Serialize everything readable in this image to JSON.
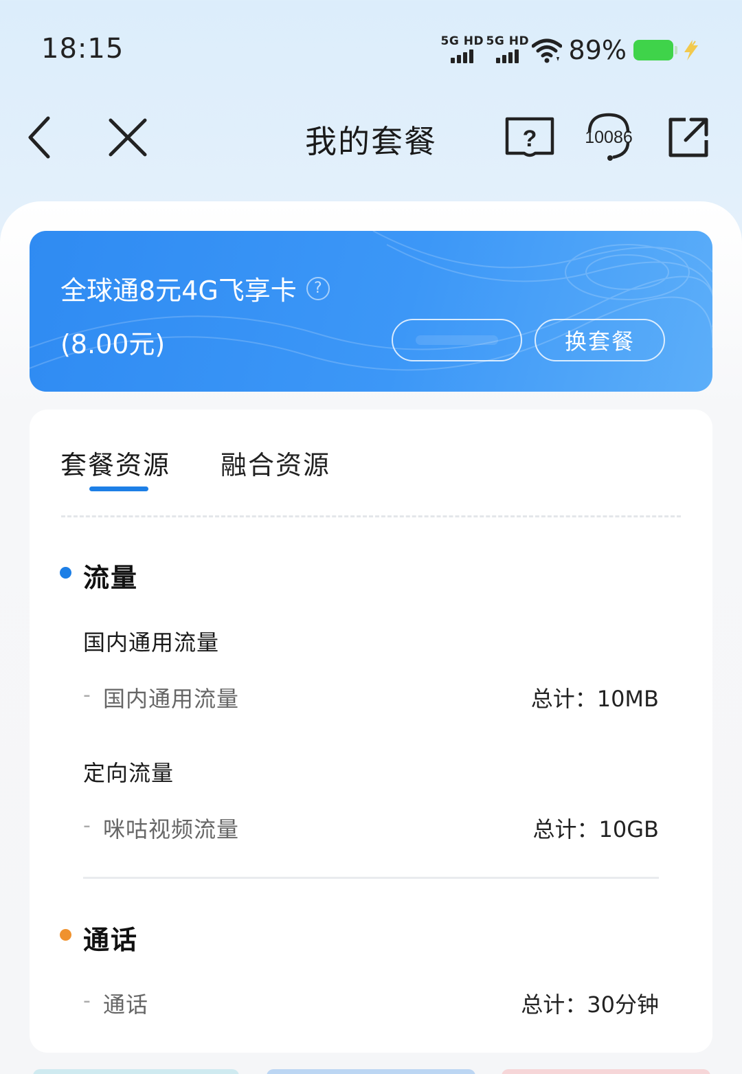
{
  "status_bar": {
    "time": "18:15",
    "sim1_label": "5G HD",
    "sim2_label": "5G HD",
    "battery_percent": "89%",
    "battery_level": 0.89,
    "battery_color": "#3fd34a"
  },
  "nav": {
    "title": "我的套餐",
    "back_icon": "chevron-left-icon",
    "close_icon": "close-icon",
    "help_icon": "help-book-icon",
    "service_icon": "customer-service-icon",
    "service_number": "10086",
    "share_icon": "external-link-icon"
  },
  "plan": {
    "name": "全球通8元4G飞享卡",
    "price": "(8.00元)",
    "change_button": "换套餐",
    "accent": "#2f8bf2"
  },
  "resources": {
    "tabs": [
      {
        "label": "套餐资源",
        "active": true
      },
      {
        "label": "融合资源",
        "active": false
      }
    ],
    "sections": [
      {
        "title": "流量",
        "dot_color": "#1d7fe6",
        "groups": [
          {
            "title": "国内通用流量",
            "rows": [
              {
                "dash": "-",
                "label": "国内通用流量",
                "value": "总计：10MB"
              }
            ]
          },
          {
            "title": "定向流量",
            "rows": [
              {
                "dash": "-",
                "label": "咪咕视频流量",
                "value": "总计：10GB"
              }
            ]
          }
        ]
      },
      {
        "title": "通话",
        "dot_color": "#f0922e",
        "rows": [
          {
            "dash": "-",
            "label": "通话",
            "value": "总计：30分钟"
          }
        ]
      }
    ]
  }
}
